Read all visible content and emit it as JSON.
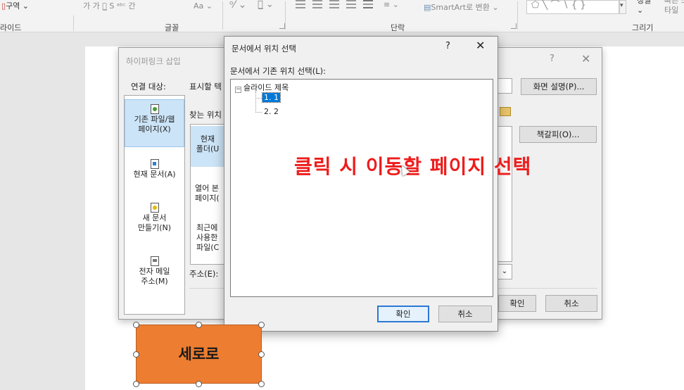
{
  "ribbon": {
    "section_label": "구역",
    "font_small_glyphs": "가  가  가̲  S  ᵃᵇᶜ  간",
    "font_case": "Aa",
    "text_direction": "SmartArt로 변환",
    "groups": {
      "slides": "라이드",
      "font": "글꼴",
      "paragraph": "단락",
      "drawing": "그리기"
    },
    "arrange_label": "정렬",
    "quick_style_label": "빠른 스타일"
  },
  "hyperlink_dialog": {
    "title": "하이퍼링크 삽입",
    "link_to_label": "연결 대상:",
    "display_text_label": "표시할 텍",
    "look_in_label": "찾는 위치",
    "screen_tip_button": "화면 설명(P)...",
    "bookmark_button": "책갈피(O)...",
    "address_label": "주소(E):",
    "ok_button": "확인",
    "cancel_button": "취소",
    "link_items": [
      {
        "line1": "기존 파일/웹",
        "line2": "페이지(X)"
      },
      {
        "line1": "현재 문서(A)",
        "line2": ""
      },
      {
        "line1": "새 문서",
        "line2": "만들기(N)"
      },
      {
        "line1": "전자 메일",
        "line2": "주소(M)"
      }
    ],
    "browse_items": [
      {
        "line1": "현재",
        "line2": "폴더(U"
      },
      {
        "line1": "열어 본",
        "line2": "페이지("
      },
      {
        "line1": "최근에",
        "line2": "사용한",
        "line3": "파일(C"
      }
    ]
  },
  "place_dialog": {
    "title": "문서에서 위치 선택",
    "help": "?",
    "close": "✕",
    "tree_label": "문서에서 기존 위치 선택(L):",
    "tree": {
      "root": "슬라이드 제목",
      "children": [
        "1. 1",
        "2. 2"
      ],
      "selected_index": 0
    },
    "ok_button": "확인",
    "cancel_button": "취소"
  },
  "annotation": "클릭 시 이동할 페이지 선택",
  "slide_shape": {
    "text": "세로로",
    "fill": "#ed7d31"
  },
  "colors": {
    "accent": "#0078d7",
    "annotation": "#ee1c1c",
    "selection_bg": "#cce4f7"
  }
}
